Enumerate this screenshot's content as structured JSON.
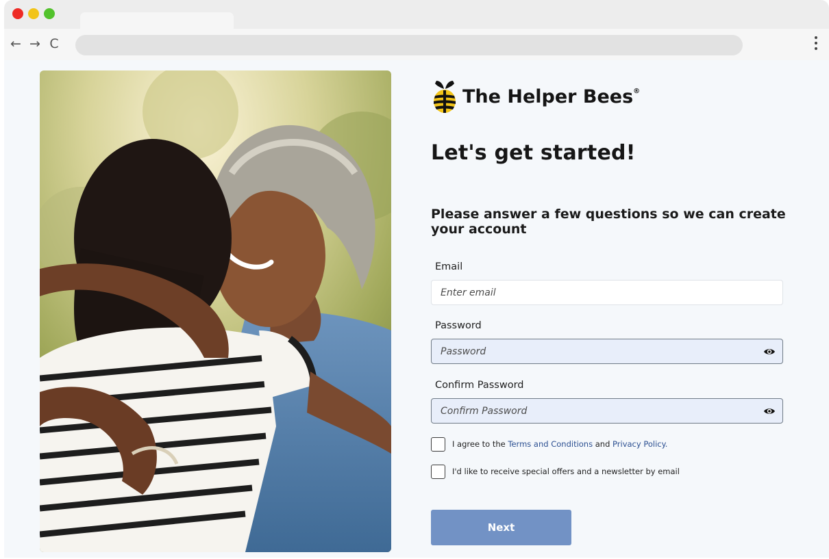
{
  "browser": {
    "nav": {
      "back": "←",
      "forward": "→",
      "reload": "C"
    }
  },
  "brand": {
    "name": "The Helper Bees",
    "registered": "®",
    "colors": {
      "accent": "#7292c5",
      "link": "#2b4f91",
      "bee_yellow": "#f2c418"
    }
  },
  "form": {
    "title": "Let's get started!",
    "subtitle": "Please answer a few questions so we can create your account",
    "email": {
      "label": "Email",
      "placeholder": "Enter email"
    },
    "password": {
      "label": "Password",
      "placeholder": "Password",
      "icon": "eye-icon"
    },
    "confirm_password": {
      "label": "Confirm Password",
      "placeholder": "Confirm Password",
      "icon": "eye-icon"
    },
    "terms": {
      "prefix": "I agree to the ",
      "terms_link": "Terms and Conditions",
      "middle": " and ",
      "privacy_link": "Privacy Policy",
      "suffix": "."
    },
    "newsletter": {
      "label": "I'd like to receive special offers and a newsletter by email"
    },
    "next_label": "Next"
  }
}
